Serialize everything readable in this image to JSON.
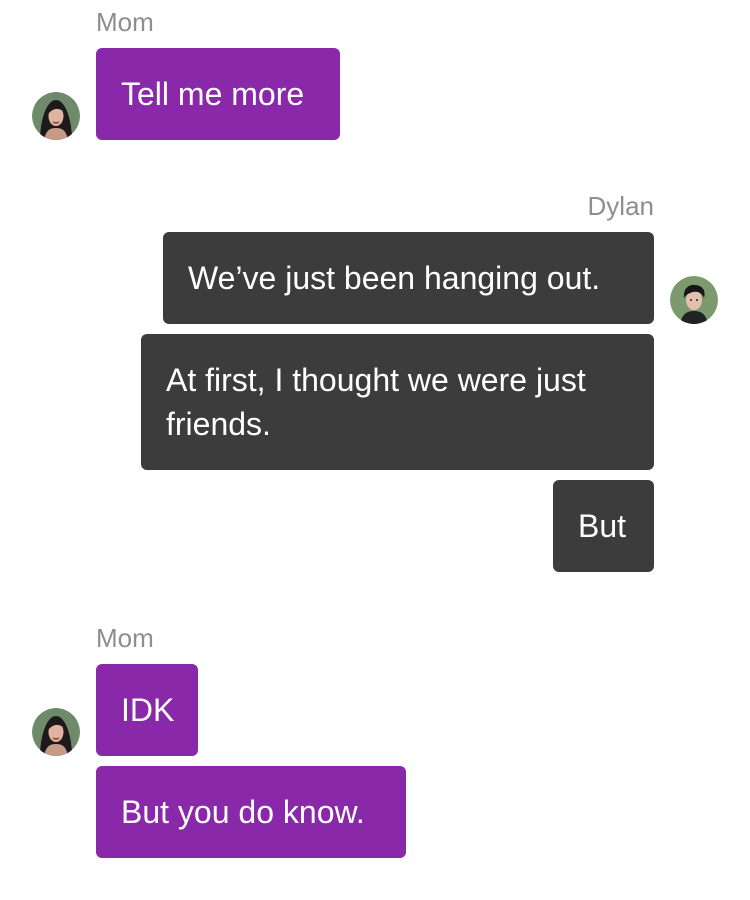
{
  "contacts": {
    "mom": {
      "name": "Mom",
      "avatar_icon": "mom-avatar-icon",
      "bubble_color": "#8a28aa"
    },
    "dylan": {
      "name": "Dylan",
      "avatar_icon": "dylan-avatar-icon",
      "bubble_color": "#3c3c3c"
    }
  },
  "groups": [
    {
      "sender": "Mom",
      "side": "left",
      "messages": [
        {
          "text": "Tell me more"
        }
      ]
    },
    {
      "sender": "Dylan",
      "side": "right",
      "messages": [
        {
          "text": "We’ve just been hanging out."
        },
        {
          "text": "At first, I thought we were just friends."
        },
        {
          "text": "But"
        }
      ]
    },
    {
      "sender": "Mom",
      "side": "left",
      "messages": [
        {
          "text": "IDK"
        },
        {
          "text": "But you do know."
        }
      ]
    }
  ]
}
